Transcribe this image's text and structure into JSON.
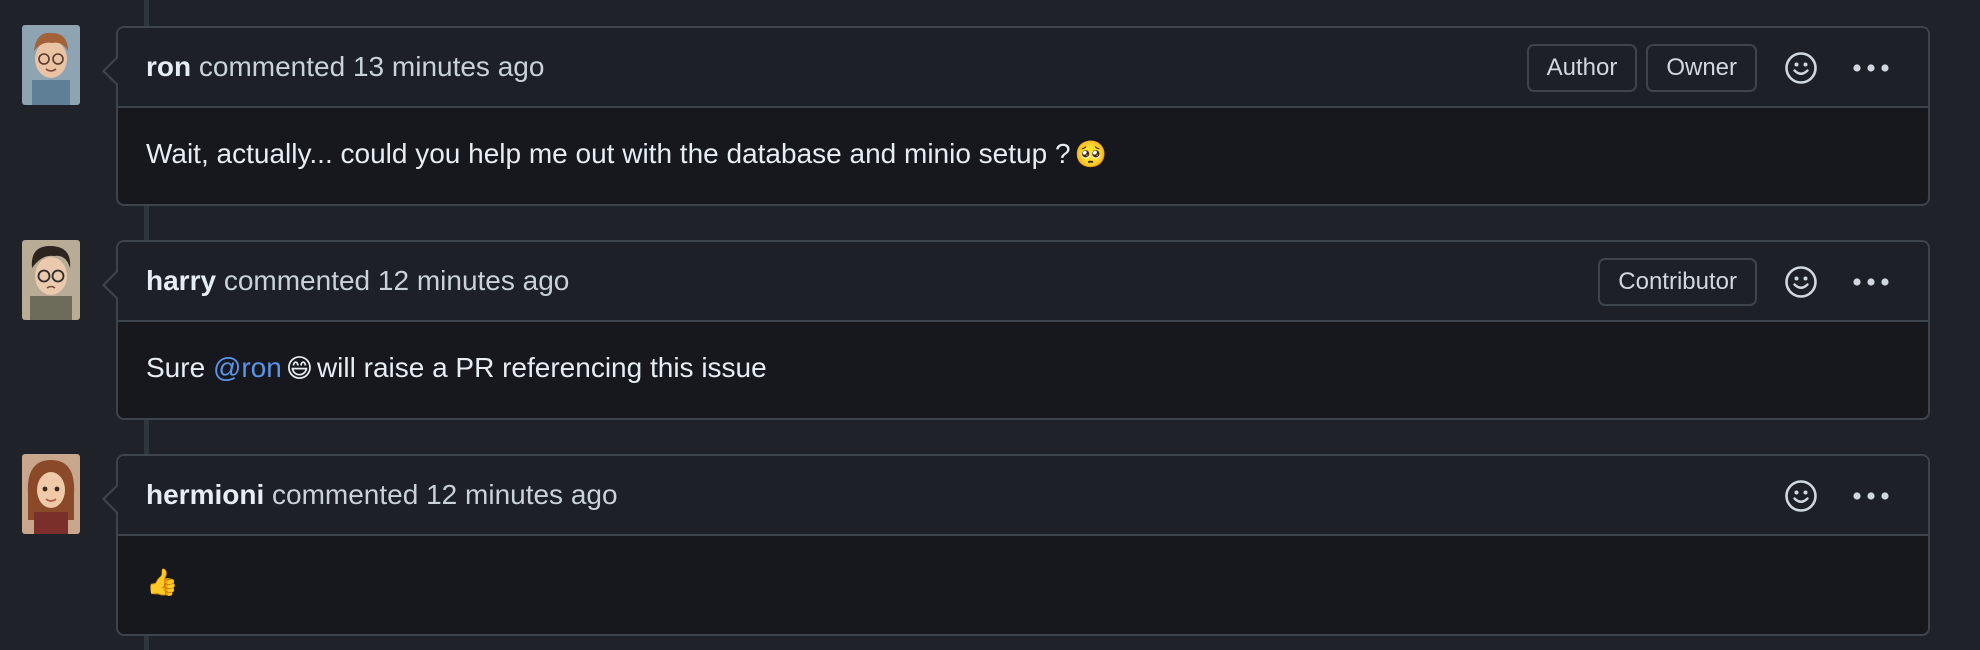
{
  "comments": [
    {
      "author": "ron",
      "action": "commented",
      "time": "13 minutes ago",
      "badges": [
        "Author",
        "Owner"
      ],
      "body": {
        "text_before": "Wait, actually... could you help me out with the database and minio setup ?",
        "emoji": "🥺",
        "mention": "",
        "text_after": ""
      }
    },
    {
      "author": "harry",
      "action": "commented",
      "time": "12 minutes ago",
      "badges": [
        "Contributor"
      ],
      "body": {
        "text_before": "Sure",
        "mention": "@ron",
        "emoji": "😄",
        "text_after": "will raise a PR referencing this issue"
      }
    },
    {
      "author": "hermioni",
      "action": "commented",
      "time": "12 minutes ago",
      "badges": [],
      "body": {
        "text_before": "",
        "mention": "",
        "emoji": "👍",
        "text_after": ""
      }
    }
  ],
  "icons": {
    "reaction": "smiley-icon",
    "menu": "kebab-horizontal-icon"
  },
  "colors": {
    "background": "#1f2229",
    "mention": "#5b93e8",
    "border": "#3d444d"
  }
}
